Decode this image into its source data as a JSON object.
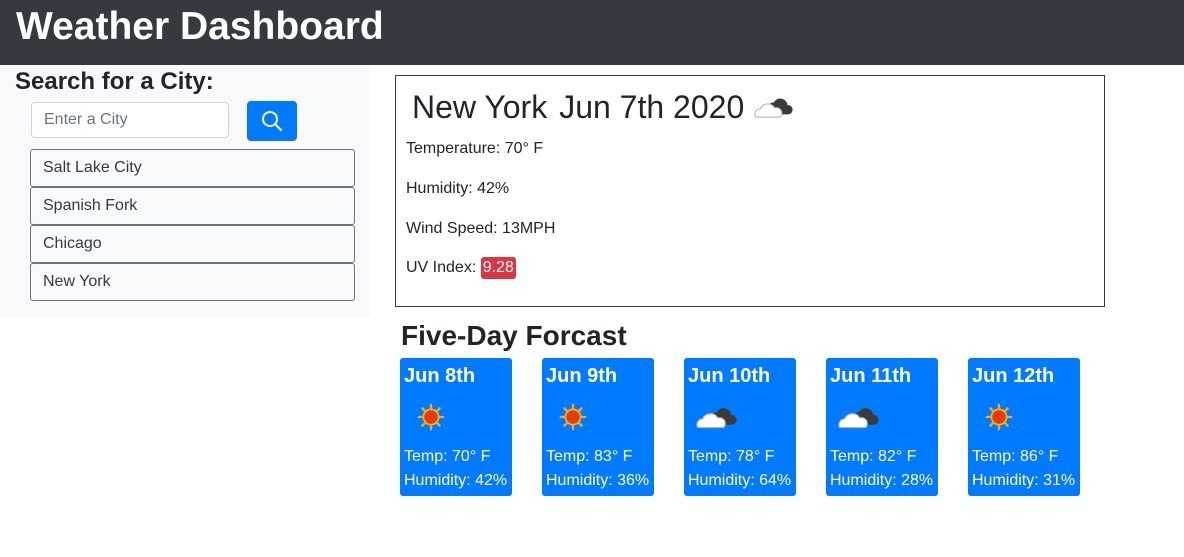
{
  "header": {
    "title": "Weather Dashboard"
  },
  "sidebar": {
    "title": "Search for a City:",
    "search": {
      "placeholder": "Enter a City",
      "value": ""
    },
    "search_button_icon": "search-icon",
    "cities": [
      "Salt Lake City",
      "Spanish Fork",
      "Chicago",
      "New York"
    ]
  },
  "current": {
    "city": "New York",
    "date": "Jun 7th 2020",
    "icon": "cloud-icon",
    "temperature": "Temperature: 70° F",
    "humidity": "Humidity: 42%",
    "wind": "Wind Speed: 13MPH",
    "uv_label": "UV Index: ",
    "uv_value": "9.28"
  },
  "forecast": {
    "title": "Five-Day Forcast",
    "days": [
      {
        "date": "Jun 8th",
        "icon": "sun-icon",
        "temp": "Temp: 70° F",
        "humidity": "Humidity: 42%"
      },
      {
        "date": "Jun 9th",
        "icon": "sun-icon",
        "temp": "Temp: 83° F",
        "humidity": "Humidity: 36%"
      },
      {
        "date": "Jun 10th",
        "icon": "cloud-icon",
        "temp": "Temp: 78° F",
        "humidity": "Humidity: 64%"
      },
      {
        "date": "Jun 11th",
        "icon": "cloud-icon",
        "temp": "Temp: 82° F",
        "humidity": "Humidity: 28%"
      },
      {
        "date": "Jun 12th",
        "icon": "sun-icon",
        "temp": "Temp: 86° F",
        "humidity": "Humidity: 31%"
      }
    ]
  },
  "colors": {
    "navbar": "#343a40",
    "accent": "#007bff",
    "uv_danger": "#dc3545",
    "sidebar_bg": "#f8f9fa"
  }
}
